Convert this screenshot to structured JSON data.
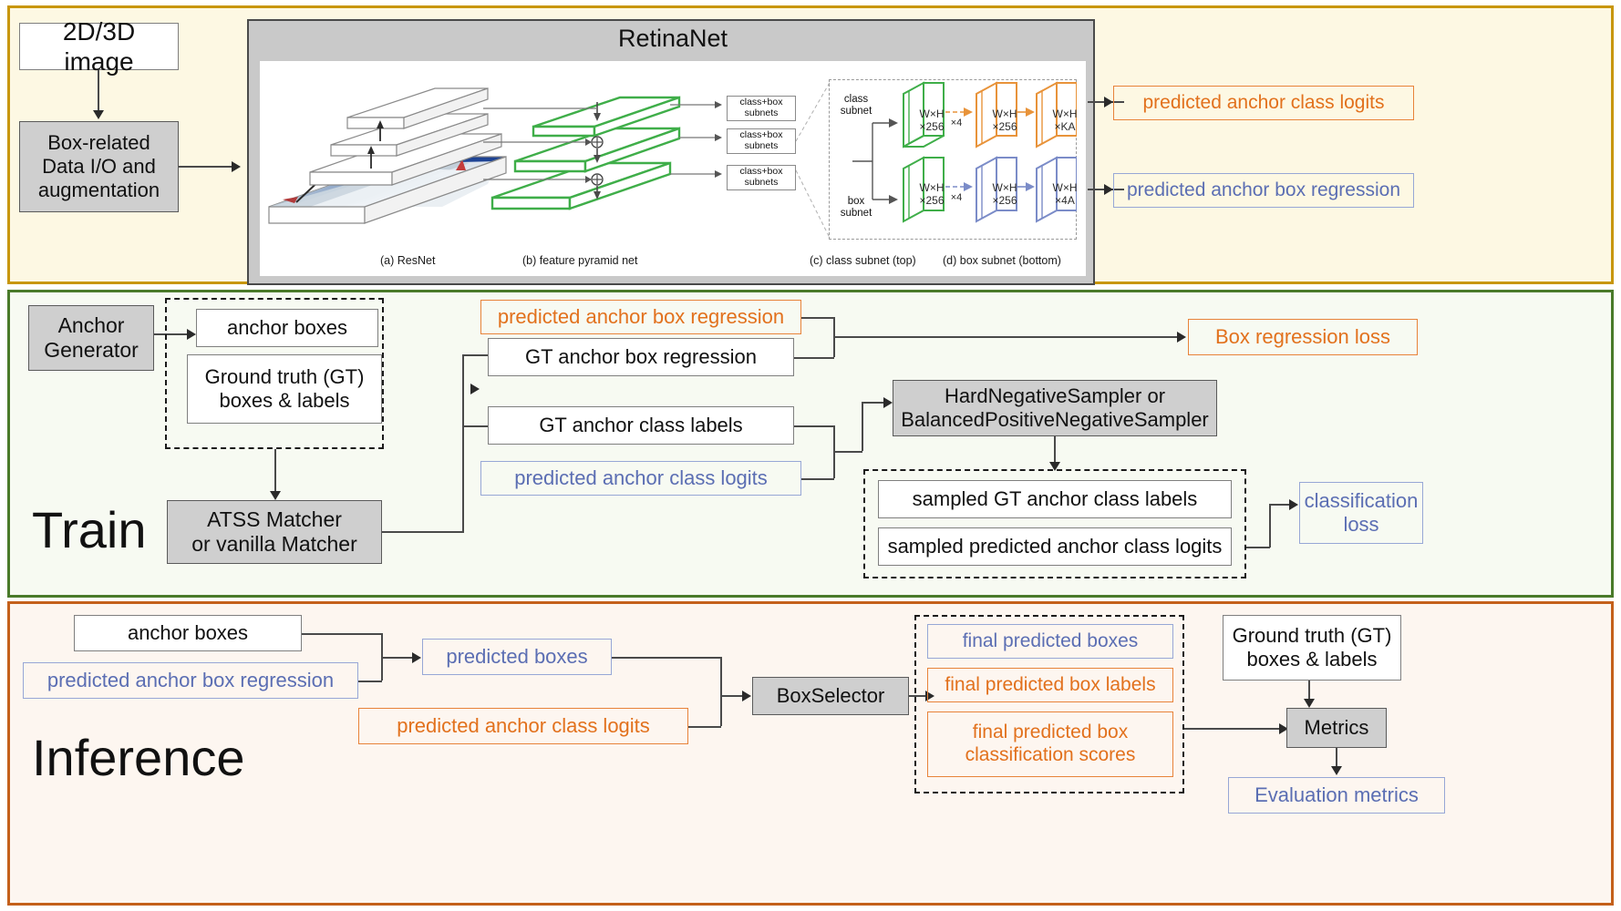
{
  "panels": {
    "top": {
      "accent": "#c8960c",
      "bg": "#fdf8e3"
    },
    "train": {
      "title": "Train",
      "accent": "#4a7a2a",
      "bg": "#f7faf2"
    },
    "inference": {
      "title": "Inference",
      "accent": "#c4601b",
      "bg": "#fdf6f0"
    }
  },
  "colors": {
    "orange": "#e2711d",
    "blue": "#5b6eb3",
    "gray_fill": "#cfcfcf",
    "green": "#3fae49"
  },
  "top": {
    "image_box": "2D/3D image",
    "io_box": "Box-related\nData I/O and\naugmentation",
    "io_box_lines": [
      "Box-related",
      "Data I/O and",
      "augmentation"
    ],
    "retinanet": {
      "title": "RetinaNet",
      "subnet_labels": [
        "class+box\nsubnets",
        "class+box\nsubnets",
        "class+box\nsubnets"
      ],
      "subnet_lines": [
        "class+box",
        "subnets"
      ],
      "class_subnet_label": [
        "class",
        "subnet"
      ],
      "box_subnet_label": [
        "box",
        "subnet"
      ],
      "cubes": {
        "class_green": [
          "W×H",
          "×256"
        ],
        "class_orange_mid": [
          "W×H",
          "×256"
        ],
        "class_orange_out": [
          "W×H",
          "×KA"
        ],
        "box_green": [
          "W×H",
          "×256"
        ],
        "box_blue_mid": [
          "W×H",
          "×256"
        ],
        "box_blue_out": [
          "W×H",
          "×4A"
        ]
      },
      "repeat_label": "×4",
      "captions": [
        "(a) ResNet",
        "(b) feature pyramid net",
        "(c) class subnet (top)",
        "(d) box subnet (bottom)"
      ]
    },
    "outputs": {
      "class_logits": "predicted anchor class logits",
      "box_regression": "predicted anchor box regression"
    }
  },
  "train": {
    "anchor_generator": [
      "Anchor",
      "Generator"
    ],
    "anchor_boxes": "anchor boxes",
    "gt_boxes_labels": [
      "Ground truth (GT)",
      "boxes & labels"
    ],
    "matcher": [
      "ATSS Matcher",
      "or vanilla Matcher"
    ],
    "pred_box_regression": "predicted anchor box regression",
    "gt_box_regression": "GT anchor box regression",
    "gt_class_labels": "GT anchor class labels",
    "pred_class_logits": "predicted anchor class logits",
    "sampler": [
      "HardNegativeSampler or",
      "BalancedPositiveNegativeSampler"
    ],
    "sampled_gt_class_labels": "sampled GT anchor class labels",
    "sampled_pred_class_logits": "sampled predicted anchor class logits",
    "box_regression_loss": "Box regression loss",
    "classification_loss": [
      "classification",
      "loss"
    ]
  },
  "inference": {
    "anchor_boxes": "anchor boxes",
    "pred_anchor_box_regression": "predicted anchor box regression",
    "predicted_boxes": "predicted boxes",
    "pred_anchor_class_logits": "predicted anchor class logits",
    "box_selector": "BoxSelector",
    "final_predicted_boxes": "final predicted boxes",
    "final_predicted_box_labels": "final predicted box labels",
    "final_predicted_box_scores": [
      "final predicted box",
      "classification scores"
    ],
    "gt_boxes_labels": [
      "Ground truth (GT)",
      "boxes & labels"
    ],
    "metrics": "Metrics",
    "evaluation_metrics": "Evaluation metrics"
  }
}
